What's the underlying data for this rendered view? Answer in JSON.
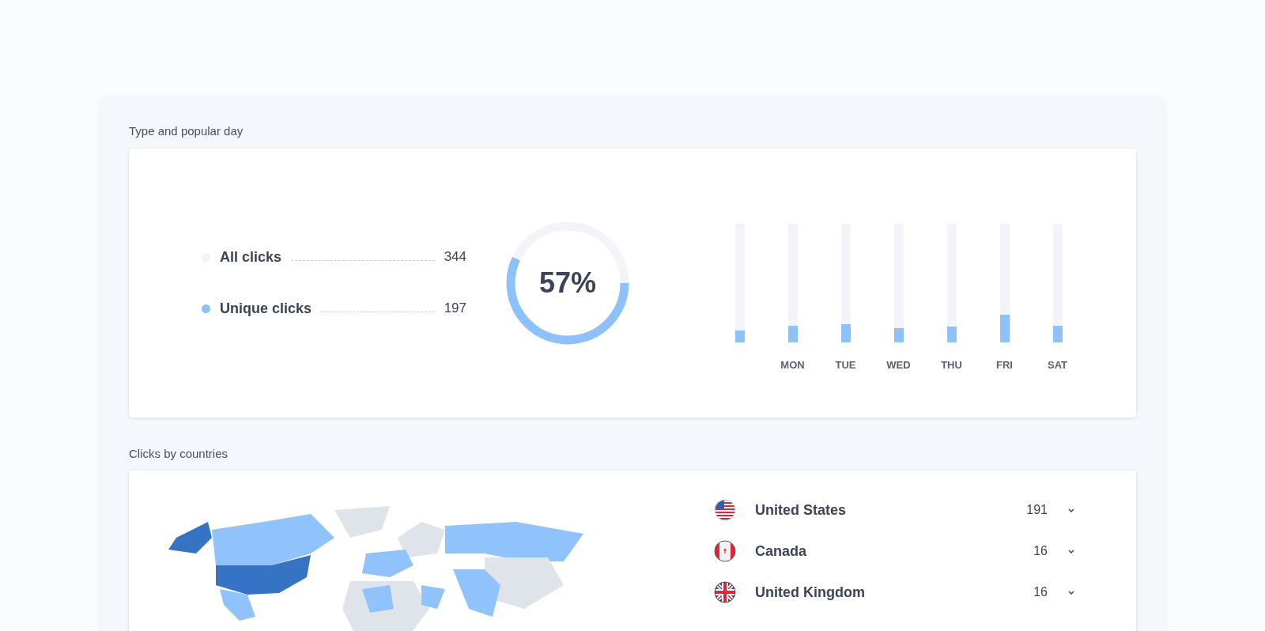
{
  "sections": [
    {
      "title": "Type and popular day"
    },
    {
      "title": "Clicks by countries"
    }
  ],
  "legend": [
    {
      "label": "All clicks",
      "value": "344",
      "color": "#f1f3f8"
    },
    {
      "label": "Unique clicks",
      "value": "197",
      "color": "#8dc1fb"
    }
  ],
  "donut": {
    "level": 0.57,
    "label": "57%"
  },
  "days": [
    {
      "level": 0.1
    },
    {
      "label": "MON",
      "level": 0.14
    },
    {
      "label": "TUE",
      "level": 0.15
    },
    {
      "label": "WED",
      "level": 0.12
    },
    {
      "label": "THU",
      "level": 0.13
    },
    {
      "label": "FRI",
      "level": 0.23
    },
    {
      "label": "SAT",
      "level": 0.14
    }
  ],
  "countries": [
    {
      "kind": "us",
      "name": "United States",
      "count": "191",
      "expanded": false
    },
    {
      "kind": "ca",
      "name": "Canada",
      "count": "16",
      "expanded": false
    },
    {
      "kind": "gb",
      "name": "United Kingdom",
      "count": "16",
      "expanded": false
    }
  ]
}
